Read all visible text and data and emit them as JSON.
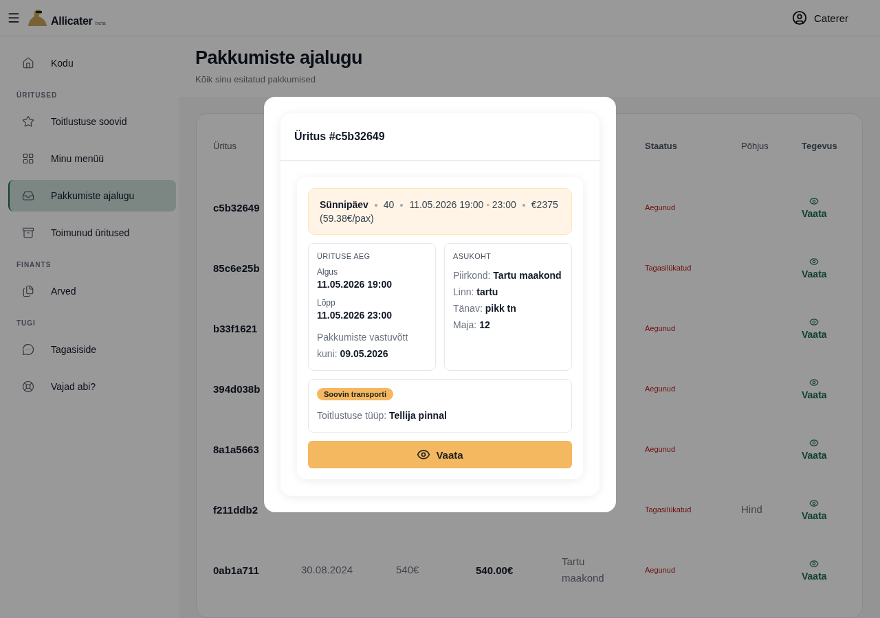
{
  "header": {
    "logo": "Allicater",
    "logo_badge": "beta",
    "user": "Caterer"
  },
  "sidebar": {
    "items": [
      {
        "kind": "item",
        "label": "Kodu",
        "selected": false
      },
      {
        "kind": "section",
        "label": "ÜRITUSED"
      },
      {
        "kind": "item",
        "label": "Toitlustuse soovid",
        "selected": false
      },
      {
        "kind": "item",
        "label": "Minu menüü",
        "selected": false
      },
      {
        "kind": "item",
        "label": "Pakkumiste ajalugu",
        "selected": true
      },
      {
        "kind": "item",
        "label": "Toimunud üritused",
        "selected": false
      },
      {
        "kind": "section",
        "label": "FINANTS"
      },
      {
        "kind": "item",
        "label": "Arved",
        "selected": false
      },
      {
        "kind": "section",
        "label": "TUGI"
      },
      {
        "kind": "item",
        "label": "Tagasiside",
        "selected": false
      },
      {
        "kind": "item",
        "label": "Vajad abi?",
        "selected": false
      }
    ]
  },
  "page": {
    "title": "Pakkumiste ajalugu",
    "subtitle": "Kõik sinu esitatud pakkumised"
  },
  "table": {
    "columns": {
      "event": "Üritus",
      "status": "Staatus",
      "reason": "Põhjus",
      "action": "Tegevus"
    },
    "rows": [
      {
        "event": "c5b32649",
        "status": "Aegunud",
        "action": "Vaata"
      },
      {
        "event": "85c6e25b",
        "status": "Tagasilükatud",
        "action": "Vaata"
      },
      {
        "event": "b33f1621",
        "status": "Aegunud",
        "action": "Vaata"
      },
      {
        "event": "394d038b",
        "status": "Aegunud",
        "action": "Vaata"
      },
      {
        "event": "8a1a5663",
        "status": "Aegunud",
        "action": "Vaata"
      },
      {
        "event": "f211ddb2",
        "status": "Tagasilükatud",
        "reason": "Hind",
        "action": "Vaata"
      },
      {
        "event": "0ab1a711",
        "column_2": "30.08.2024",
        "column_3": "540€",
        "column_4": "540.00€",
        "column_5": "Tartu maakond",
        "status": "Aegunud",
        "action": "Vaata"
      }
    ]
  },
  "modal": {
    "title": "Üritus #c5b32649",
    "summary": [
      "Sünnipäev",
      "40",
      "11.05.2026 19:00 - 23:00",
      "€2375 (59.38€/pax)"
    ],
    "time": {
      "heading": "ÜRITUSE AEG",
      "fields": [
        {
          "label": "Algus",
          "value": "11.05.2026 19:00"
        },
        {
          "label": "Lõpp",
          "value": "11.05.2026 23:00"
        }
      ],
      "deadline": "Pakkumiste vastuvõtt kuni: **09.05.2026**"
    },
    "location": {
      "heading": "ASUKOHT",
      "lines": [
        "Piirkond: **Tartu maakond**",
        "Linn: **tartu**",
        "Tänav: **pikk tn**",
        "Maja: **12**"
      ]
    },
    "extra": {
      "badge": "Soovin transporti",
      "line": "Toitlustuse tüüp: **Tellija pinnal**"
    },
    "button": "Vaata"
  }
}
